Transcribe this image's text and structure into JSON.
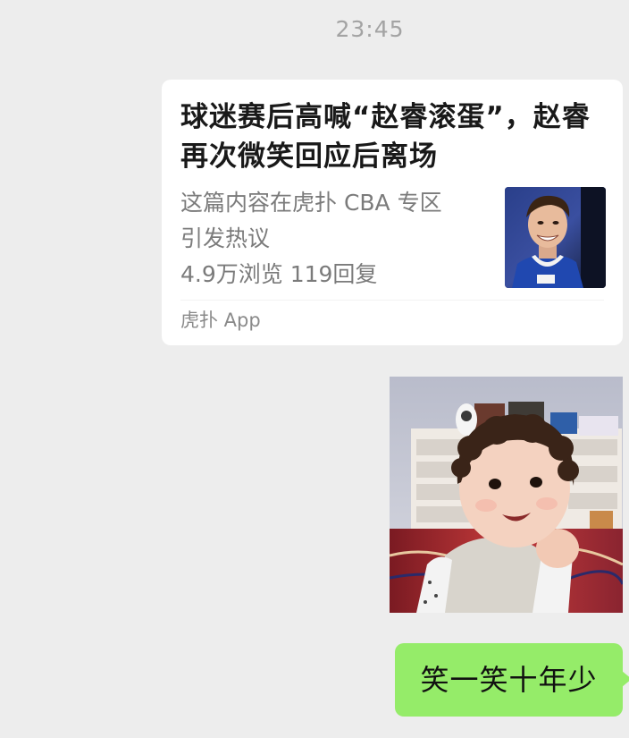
{
  "chat": {
    "timestamp": "23:45",
    "link_card": {
      "title": "球迷赛后高喊“赵睿滚蛋”，赵睿再次微笑回应后离场",
      "desc_line1": "这篇内容在虎扑 CBA 专区",
      "desc_line2": "引发热议",
      "stats": "4.9万浏览 119回复",
      "source": "虎扑 App",
      "thumbnail_icon": "player-photo-thumbnail"
    },
    "photo_icon": "smiling-child-photo",
    "message_text": "笑一笑十年少"
  },
  "colors": {
    "background": "#ededed",
    "bubble_green": "#95ec69",
    "card_white": "#ffffff"
  }
}
